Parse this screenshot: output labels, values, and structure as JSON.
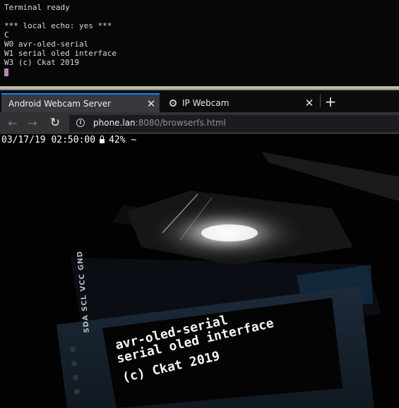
{
  "terminal": {
    "lines": [
      "Terminal ready",
      "",
      "*** local echo: yes ***",
      "C",
      "W0 avr-oled-serial",
      "W1 serial oled interface",
      "W3 (c) Ckat 2019"
    ]
  },
  "browser": {
    "tabs": [
      {
        "label": "Android Webcam Server",
        "active": true
      },
      {
        "label": "IP Webcam",
        "active": false
      }
    ],
    "url": {
      "host": "phone.lan",
      "rest": ":8080/browserfs.html"
    }
  },
  "webcam": {
    "overlay": {
      "datetime": "03/17/19 02:50:00",
      "battery": "42%",
      "signal": "~"
    },
    "oled": {
      "line1": "avr-oled-serial",
      "line2": "serial oled interface",
      "line3": "(c) Ckat 2019"
    },
    "pins": "SDA SCL VCC GND"
  },
  "colors": {
    "tab_accent": "#0a84ff",
    "terminal_cursor": "#b78ab0",
    "tab_active_bg": "#38383d",
    "navbar_bg": "#323234"
  }
}
